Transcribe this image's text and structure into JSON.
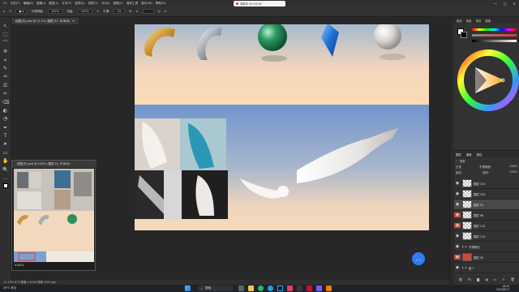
{
  "menubar": {
    "items": [
      "文件(F)",
      "编辑(E)",
      "图像(I)",
      "图层(L)",
      "文字(Y)",
      "选择(S)",
      "滤镜(T)",
      "3D(D)",
      "视图(V)",
      "增效工具",
      "窗口(W)",
      "帮助(H)"
    ]
  },
  "recorder": {
    "label": "录制中 00:33:36"
  },
  "window_controls": {
    "minimize": "—",
    "maximize": "□",
    "close": "✕"
  },
  "options": {
    "feather_label": "羽化:",
    "feather_value": "0像素",
    "antialias_label": "消除锯齿",
    "style_label": "样式:",
    "style_value": "正常",
    "width_label": "宽度:",
    "height_label": "高度:",
    "select_mask_label": "选择并遮住..."
  },
  "options_values": {
    "opacity_label": "不透明度:",
    "opacity_value": "100%",
    "flow_label": "流量:",
    "flow_value": "100%",
    "smooth_label": "平滑:",
    "smooth_value": "0%"
  },
  "document_tab": {
    "title": "纹图(无).psd @ 11.2% (图层 41, RGB/8)",
    "close": "✕"
  },
  "tools": [
    "↖",
    "⬚",
    "⌒",
    "✣",
    "⌖",
    "✎",
    "♒",
    "⎚",
    "✂",
    "⌫",
    "◐",
    "◔",
    "✒",
    "T",
    "➤",
    "▭",
    "✋",
    "🔍",
    "…",
    "■"
  ],
  "navigator": {
    "title": "纹图(无).psd @ 4.82% (图层 41, RGB/8)",
    "zoom": "4.82%"
  },
  "status": {
    "text": "11.19%   873 像素 x 4249 像素 (300 ppi)"
  },
  "color_panel": {
    "tabs": [
      "颜色",
      "色板",
      "渐变",
      "图案"
    ]
  },
  "layers_panel": {
    "tabs": [
      "图层",
      "通道",
      "路径"
    ],
    "kind_label": "类型",
    "blend_mode": "正常",
    "opacity_label": "不透明度:",
    "opacity_value": "100%",
    "lock_label": "锁定:",
    "fill_label": "填充:",
    "fill_value": "100%",
    "rows": [
      {
        "name": "图层 104"
      },
      {
        "name": "图层 103"
      },
      {
        "name": "图层 41"
      },
      {
        "name": "图层 98"
      },
      {
        "name": "图层 113"
      },
      {
        "name": "图层 112"
      },
      {
        "name": "不透明光"
      },
      {
        "name": "图层 30"
      },
      {
        "name": "组 1"
      }
    ]
  },
  "taskbar": {
    "weather": "29°C 多云",
    "search_placeholder": "搜索",
    "time": "18:45",
    "date": "2024/6/17"
  },
  "chat_icon": "speech-bubble-icon",
  "colors": {
    "accent_blue": "#2f7df6",
    "layer_red": "#c94a3c"
  }
}
